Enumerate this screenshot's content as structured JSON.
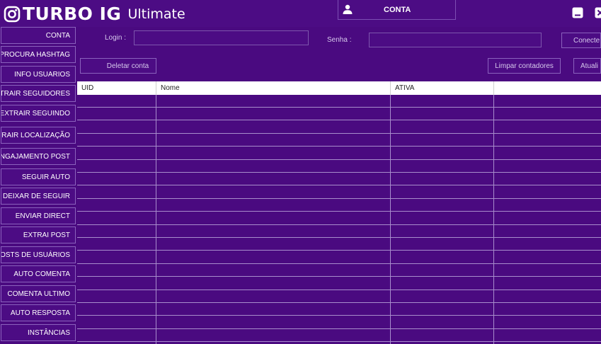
{
  "app": {
    "brand": "TURBO IG",
    "edition": "Ultimate",
    "account_tab": "CONTA"
  },
  "sidebar": {
    "items": [
      {
        "label": "CONTA"
      },
      {
        "label": "PROCURA HASHTAG"
      },
      {
        "label": "INFO USUARIOS"
      },
      {
        "label": "EXTRAIR SEGUIDORES"
      },
      {
        "label": "EXTRAIR SEGUINDO"
      },
      {
        "label": "EXTRAIR LOCALIZAÇÃO"
      },
      {
        "label": "ENGAJAMENTO POST"
      },
      {
        "label": "SEGUIR AUTO"
      },
      {
        "label": "DEIXAR DE SEGUIR"
      },
      {
        "label": "ENVIAR DIRECT"
      },
      {
        "label": "EXTRAI POST"
      },
      {
        "label": "POSTS DE USUÁRIOS"
      },
      {
        "label": "AUTO COMENTA"
      },
      {
        "label": "COMENTA ULTIMO"
      },
      {
        "label": "AUTO RESPOSTA"
      },
      {
        "label": "INSTÂNCIAS"
      }
    ]
  },
  "form": {
    "login_label": "Login :",
    "login_value": "",
    "senha_label": "Senha :",
    "senha_value": "",
    "connect_button": "Conecte",
    "delete_button": "Deletar conta",
    "clear_counters_button": "Limpar contadores",
    "update_button": "Atuali"
  },
  "table": {
    "columns": [
      "UID",
      "Nome",
      "ATIVA",
      ""
    ],
    "rows": []
  }
}
